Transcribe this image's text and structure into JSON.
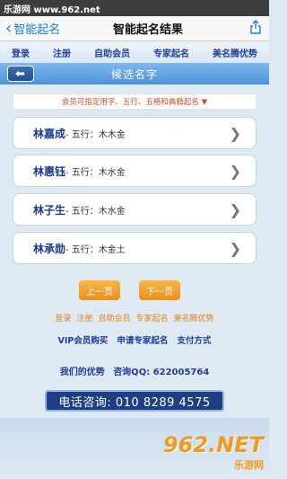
{
  "watermark_top": "乐游网 www.962.net",
  "nav": {
    "back_label": "智能起名",
    "title": "智能起名结果",
    "share_icon": "share-icon"
  },
  "top_links": [
    "登录",
    "注册",
    "自助会员",
    "专家起名",
    "美名腾优势"
  ],
  "title_bar": {
    "title": "候选名字",
    "back_icon": "arrow-left-icon"
  },
  "notice": "会员可指定用字、五行、五格和典籍起名 ▼",
  "names": [
    {
      "name": "林嘉成",
      "wuxing": " - 五行：木木金"
    },
    {
      "name": "林惠钰",
      "wuxing": " - 五行：木水金"
    },
    {
      "name": "林子生",
      "wuxing": " - 五行：木水金"
    },
    {
      "name": "林承勋",
      "wuxing": " - 五行：木金土"
    }
  ],
  "pager": {
    "prev": "上一页",
    "next": "下一页"
  },
  "footer_links": [
    "登录",
    "注册",
    "自助会员",
    "专家起名",
    "美名腾优势"
  ],
  "footer_links2": [
    "VIP会员购买",
    "申请专家起名",
    "支付方式"
  ],
  "advantage": {
    "label": "我们的优势",
    "qq": "咨询QQ:  622005764"
  },
  "phone": "电话咨询:  010 8289 4575",
  "watermark_bottom": {
    "big": "962.NET",
    "small": "乐游网"
  },
  "colors": {
    "link_blue": "#1f3f9a",
    "orange": "#e4821f",
    "title_bar": "#4a93d8",
    "phone_bg": "#1e3f82"
  }
}
